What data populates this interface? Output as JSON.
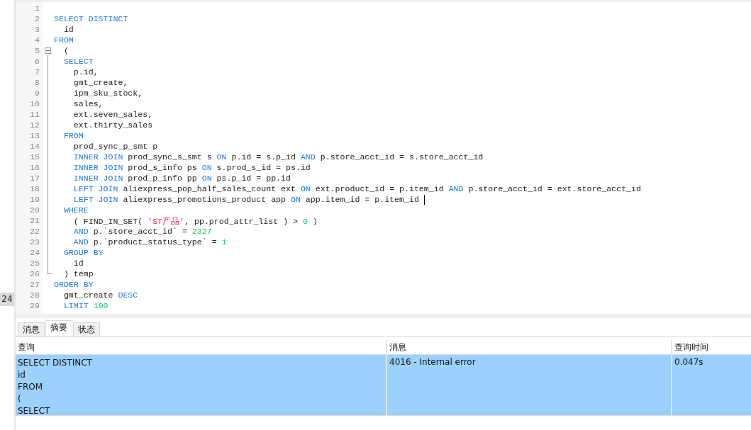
{
  "side_badge": "24",
  "editor": {
    "lines": [
      {
        "number": "1"
      },
      {
        "number": "2",
        "tokens": [
          {
            "kind": "keyword",
            "text": "SELECT DISTINCT"
          }
        ]
      },
      {
        "number": "3",
        "tokens": [
          {
            "kind": "text",
            "text": "  id"
          }
        ]
      },
      {
        "number": "4",
        "tokens": [
          {
            "kind": "keyword",
            "text": "FROM"
          }
        ]
      },
      {
        "number": "5",
        "fold_toggle": {
          "expanded": true
        },
        "tokens": [
          {
            "kind": "text",
            "text": "  ("
          }
        ]
      },
      {
        "number": "6",
        "tokens": [
          {
            "kind": "keyword",
            "text": "  SELECT"
          }
        ]
      },
      {
        "number": "7",
        "tokens": [
          {
            "kind": "text",
            "text": "    p.id,"
          }
        ]
      },
      {
        "number": "8",
        "tokens": [
          {
            "kind": "text",
            "text": "    gmt_create,"
          }
        ]
      },
      {
        "number": "9",
        "tokens": [
          {
            "kind": "text",
            "text": "    ipm_sku_stock,"
          }
        ]
      },
      {
        "number": "10",
        "tokens": [
          {
            "kind": "text",
            "text": "    sales,"
          }
        ]
      },
      {
        "number": "11",
        "tokens": [
          {
            "kind": "text",
            "text": "    ext.seven_sales,"
          }
        ]
      },
      {
        "number": "12",
        "tokens": [
          {
            "kind": "text",
            "text": "    ext.thirty_sales"
          }
        ]
      },
      {
        "number": "13",
        "tokens": [
          {
            "kind": "keyword",
            "text": "  FROM"
          }
        ]
      },
      {
        "number": "14",
        "tokens": [
          {
            "kind": "text",
            "text": "    prod_sync_p_smt p"
          }
        ]
      },
      {
        "number": "15",
        "tokens": [
          {
            "kind": "keyword",
            "text": "    INNER JOIN"
          },
          {
            "kind": "text",
            "text": " prod_sync_s_smt s "
          },
          {
            "kind": "keyword",
            "text": "ON"
          },
          {
            "kind": "text",
            "text": " p.id = s.p_id "
          },
          {
            "kind": "keyword",
            "text": "AND"
          },
          {
            "kind": "text",
            "text": " p.store_acct_id = s.store_acct_id"
          }
        ]
      },
      {
        "number": "16",
        "tokens": [
          {
            "kind": "keyword",
            "text": "    INNER JOIN"
          },
          {
            "kind": "text",
            "text": " prod_s_info ps "
          },
          {
            "kind": "keyword",
            "text": "ON"
          },
          {
            "kind": "text",
            "text": " s.prod_s_id = ps.id"
          }
        ]
      },
      {
        "number": "17",
        "tokens": [
          {
            "kind": "keyword",
            "text": "    INNER JOIN"
          },
          {
            "kind": "text",
            "text": " prod_p_info pp "
          },
          {
            "kind": "keyword",
            "text": "ON"
          },
          {
            "kind": "text",
            "text": " ps.p_id = pp.id"
          }
        ]
      },
      {
        "number": "18",
        "tokens": [
          {
            "kind": "keyword",
            "text": "    LEFT JOIN"
          },
          {
            "kind": "text",
            "text": " aliexpress_pop_half_sales_count ext "
          },
          {
            "kind": "keyword",
            "text": "ON"
          },
          {
            "kind": "text",
            "text": " ext.product_id = p.item_id "
          },
          {
            "kind": "keyword",
            "text": "AND"
          },
          {
            "kind": "text",
            "text": " p.store_acct_id = ext.store_acct_id"
          }
        ]
      },
      {
        "number": "19",
        "cursor": true,
        "tokens": [
          {
            "kind": "keyword",
            "text": "    LEFT JOIN"
          },
          {
            "kind": "text",
            "text": " aliexpress_promotions_product app "
          },
          {
            "kind": "keyword",
            "text": "ON"
          },
          {
            "kind": "text",
            "text": " app.item_id = p.item_id "
          }
        ]
      },
      {
        "number": "20",
        "tokens": [
          {
            "kind": "keyword",
            "text": "  WHERE"
          }
        ]
      },
      {
        "number": "21",
        "tokens": [
          {
            "kind": "text",
            "text": "    ( FIND_IN_SET( "
          },
          {
            "kind": "string",
            "text": "'ST产品'"
          },
          {
            "kind": "text",
            "text": ", pp.prod_attr_list ) > "
          },
          {
            "kind": "number",
            "text": "0"
          },
          {
            "kind": "text",
            "text": " )"
          }
        ]
      },
      {
        "number": "22",
        "tokens": [
          {
            "kind": "keyword",
            "text": "    AND"
          },
          {
            "kind": "text",
            "text": " p.`store_acct_id` = "
          },
          {
            "kind": "number",
            "text": "2327"
          }
        ]
      },
      {
        "number": "23",
        "tokens": [
          {
            "kind": "keyword",
            "text": "    AND"
          },
          {
            "kind": "text",
            "text": " p.`product_status_type` = "
          },
          {
            "kind": "number",
            "text": "1"
          }
        ]
      },
      {
        "number": "24",
        "tokens": [
          {
            "kind": "keyword",
            "text": "  GROUP BY"
          }
        ]
      },
      {
        "number": "25",
        "tokens": [
          {
            "kind": "text",
            "text": "    id"
          }
        ]
      },
      {
        "number": "26",
        "fold_end": true,
        "tokens": [
          {
            "kind": "text",
            "text": "  ) temp"
          }
        ]
      },
      {
        "number": "27",
        "tokens": [
          {
            "kind": "keyword",
            "text": "ORDER BY"
          }
        ]
      },
      {
        "number": "28",
        "tokens": [
          {
            "kind": "text",
            "text": "  gmt_create "
          },
          {
            "kind": "keyword",
            "text": "DESC"
          }
        ]
      },
      {
        "number": "29",
        "tokens": [
          {
            "kind": "keyword",
            "text": "  LIMIT "
          },
          {
            "kind": "number",
            "text": "100"
          }
        ]
      }
    ]
  },
  "result_tabs": [
    {
      "label": "消息",
      "selected": false
    },
    {
      "label": "摘要",
      "selected": true
    },
    {
      "label": "状态",
      "selected": false
    }
  ],
  "table": {
    "columns": [
      "查询",
      "消息",
      "查询时间"
    ],
    "rows": [
      {
        "selected": true,
        "query_lines": [
          "SELECT DISTINCT",
          "id",
          "FROM",
          "(",
          "SELECT"
        ],
        "message": "4016 - Internal error",
        "time": "0.047s"
      }
    ]
  }
}
